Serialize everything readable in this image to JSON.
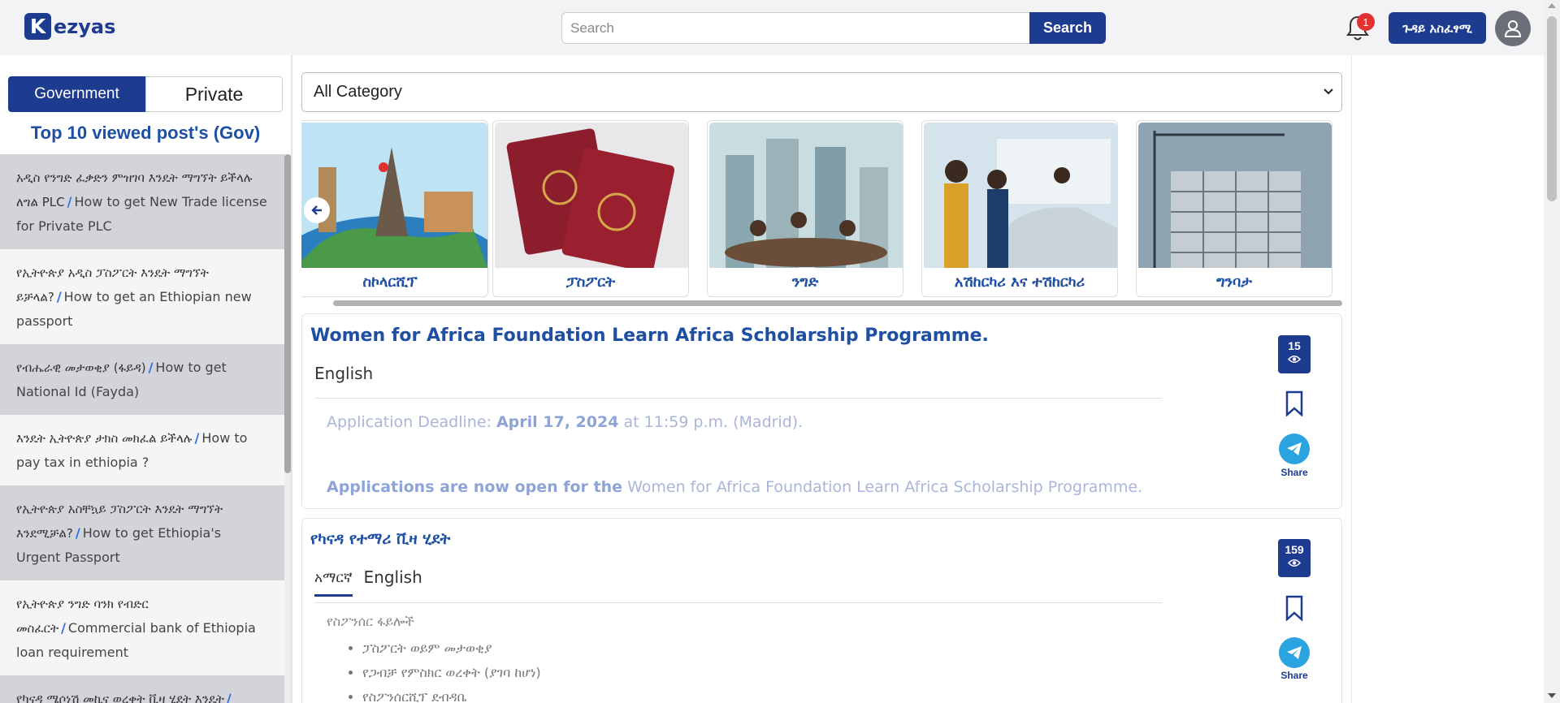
{
  "header": {
    "logo_letter": "K",
    "logo_text": "ezyas",
    "search_placeholder": "Search",
    "search_button": "Search",
    "notification_count": "1",
    "language_button": "ጉዳይ አስፈፃሚ"
  },
  "sidebar": {
    "toggle_government": "Government",
    "toggle_private": "Private",
    "title": "Top 10 viewed post's (Gov)",
    "posts": [
      {
        "am": "አዲስ የንግድ ፈቃድን ምዝገባ እንዴት ማግኘት ይችላሉ ለግል PLC",
        "en": "How to get New Trade license for Private PLC"
      },
      {
        "am": "የኢትዮጵያ አዲስ ፓስፖርት እንዴት ማግኘት ይቻላል?",
        "en": "How to get an Ethiopian new passport"
      },
      {
        "am": "የብሔራዊ መታወቂያ (ፋይዳ)",
        "en": "How to get National Id (Fayda)"
      },
      {
        "am": "እንዴት ኢትዮጵያ ታክስ መክፈል ይችላሉ",
        "en": "How to pay tax in ethiopia ?"
      },
      {
        "am": "የኢትዮጵያ አስቸኳይ ፓስፖርት እንዴት ማግኘት እንደሚቻል?",
        "en": "How to get Ethiopia's Urgent Passport"
      },
      {
        "am": "የኢትዮጵያ ንግድ ባንክ የብድር መስፈርት",
        "en": "Commercial bank of Ethiopia loan requirement"
      },
      {
        "am": "የካናዳ ሜሶነሽ መኪና ወረቀት ቪዛ ሂደት እንዴት",
        "en": ""
      }
    ]
  },
  "main": {
    "category_select": "All Category",
    "categories": [
      "ስኮላርሺፕ",
      "ፓስፖርት",
      "ንግድ",
      "አሽከርካሪ እና ተሽከርካሪ",
      "ግንባታ"
    ],
    "posts": [
      {
        "title": "Women for Africa Foundation Learn Africa Scholarship Programme.",
        "tab_en": "English",
        "views": "15",
        "deadline_label": "Application Deadline:",
        "deadline_date": "April 17, 2024",
        "deadline_time": "at 11:59 p.m. (Madrid).",
        "open_label": "Applications are now open for the",
        "open_text": "Women for Africa Foundation Learn Africa Scholarship Programme.",
        "share": "Share"
      },
      {
        "title": "የካናዳ የተማሪ ቪዛ ሂደት",
        "tab_am": "አማርኛ",
        "tab_en": "English",
        "views": "159",
        "section": "የስፖንሰር ፋይሎች",
        "items": [
          "ፓስፖርት ወይም መታወቂያ",
          "የጋብቻ የምስክር ወረቀት (ያገባ ከሆነ)",
          "የስፖንሰርሺፕ ደብዳቤ"
        ],
        "share": "Share"
      }
    ]
  },
  "icons": {
    "bell": "bell-icon",
    "avatar": "user-icon",
    "eye": "eye-icon",
    "bookmark": "bookmark-icon",
    "telegram": "telegram-icon",
    "prev": "arrow-left-icon",
    "chevron": "chevron-down-icon"
  },
  "colors": {
    "brand": "#1e3c8f",
    "link": "#1e4fa3",
    "badge": "#e23131",
    "telegram": "#2aa3e0"
  }
}
